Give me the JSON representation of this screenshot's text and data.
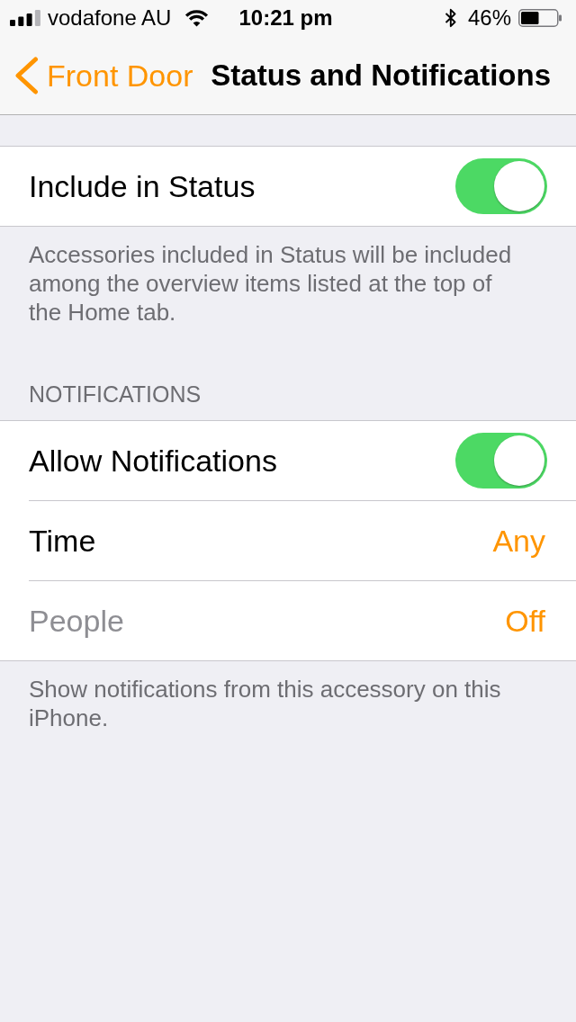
{
  "status_bar": {
    "carrier": "vodafone AU",
    "time": "10:21 pm",
    "battery": "46%"
  },
  "nav_bar": {
    "back": "Front Door",
    "title": "Status and Notifications"
  },
  "sections": [
    {
      "rows": [
        {
          "kind": "toggle",
          "label": "Include in Status",
          "on": true,
          "disabled": false
        }
      ],
      "footer": "Accessories included in Status will be included among the overview items listed at the top of the Home tab."
    },
    {
      "header": "NOTIFICATIONS",
      "rows": [
        {
          "kind": "toggle",
          "label": "Allow Notifications",
          "on": true,
          "disabled": false
        },
        {
          "kind": "value",
          "label": "Time",
          "value": "Any",
          "disabled": false
        },
        {
          "kind": "value",
          "label": "People",
          "value": "Off",
          "disabled": true
        }
      ],
      "footer": "Show notifications from this accessory on this iPhone."
    }
  ]
}
